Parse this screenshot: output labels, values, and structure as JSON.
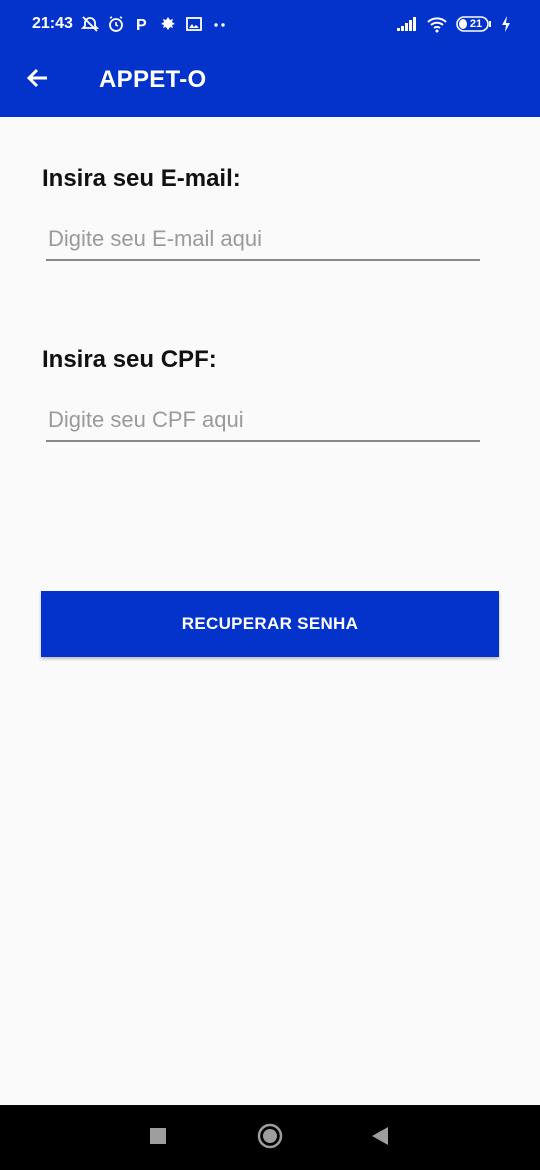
{
  "status_bar": {
    "time": "21:43",
    "left_icons": [
      "alarm-off-icon",
      "alarm-clock-icon",
      "p-app-icon",
      "leaf-app-icon",
      "gallery-notification-icon",
      "more-dots-icon"
    ],
    "battery_level": "21",
    "right_icons": [
      "cellular-signal-icon",
      "wifi-icon",
      "battery-icon",
      "charging-bolt-icon"
    ]
  },
  "toolbar": {
    "title": "APPET-O",
    "back_icon": "arrow-left-icon"
  },
  "form": {
    "email_label": "Insira seu E-mail:",
    "email_placeholder": "Digite seu E-mail aqui",
    "email_value": "",
    "cpf_label": "Insira seu CPF:",
    "cpf_placeholder": "Digite seu CPF aqui",
    "cpf_value": "",
    "submit_label": "RECUPERAR SENHA"
  },
  "nav_bar": {
    "buttons": [
      "recents-square-icon",
      "home-circle-icon",
      "back-triangle-icon"
    ]
  },
  "colors": {
    "primary": "#0433cc",
    "background": "#fafafa",
    "nav_background": "#000000"
  }
}
